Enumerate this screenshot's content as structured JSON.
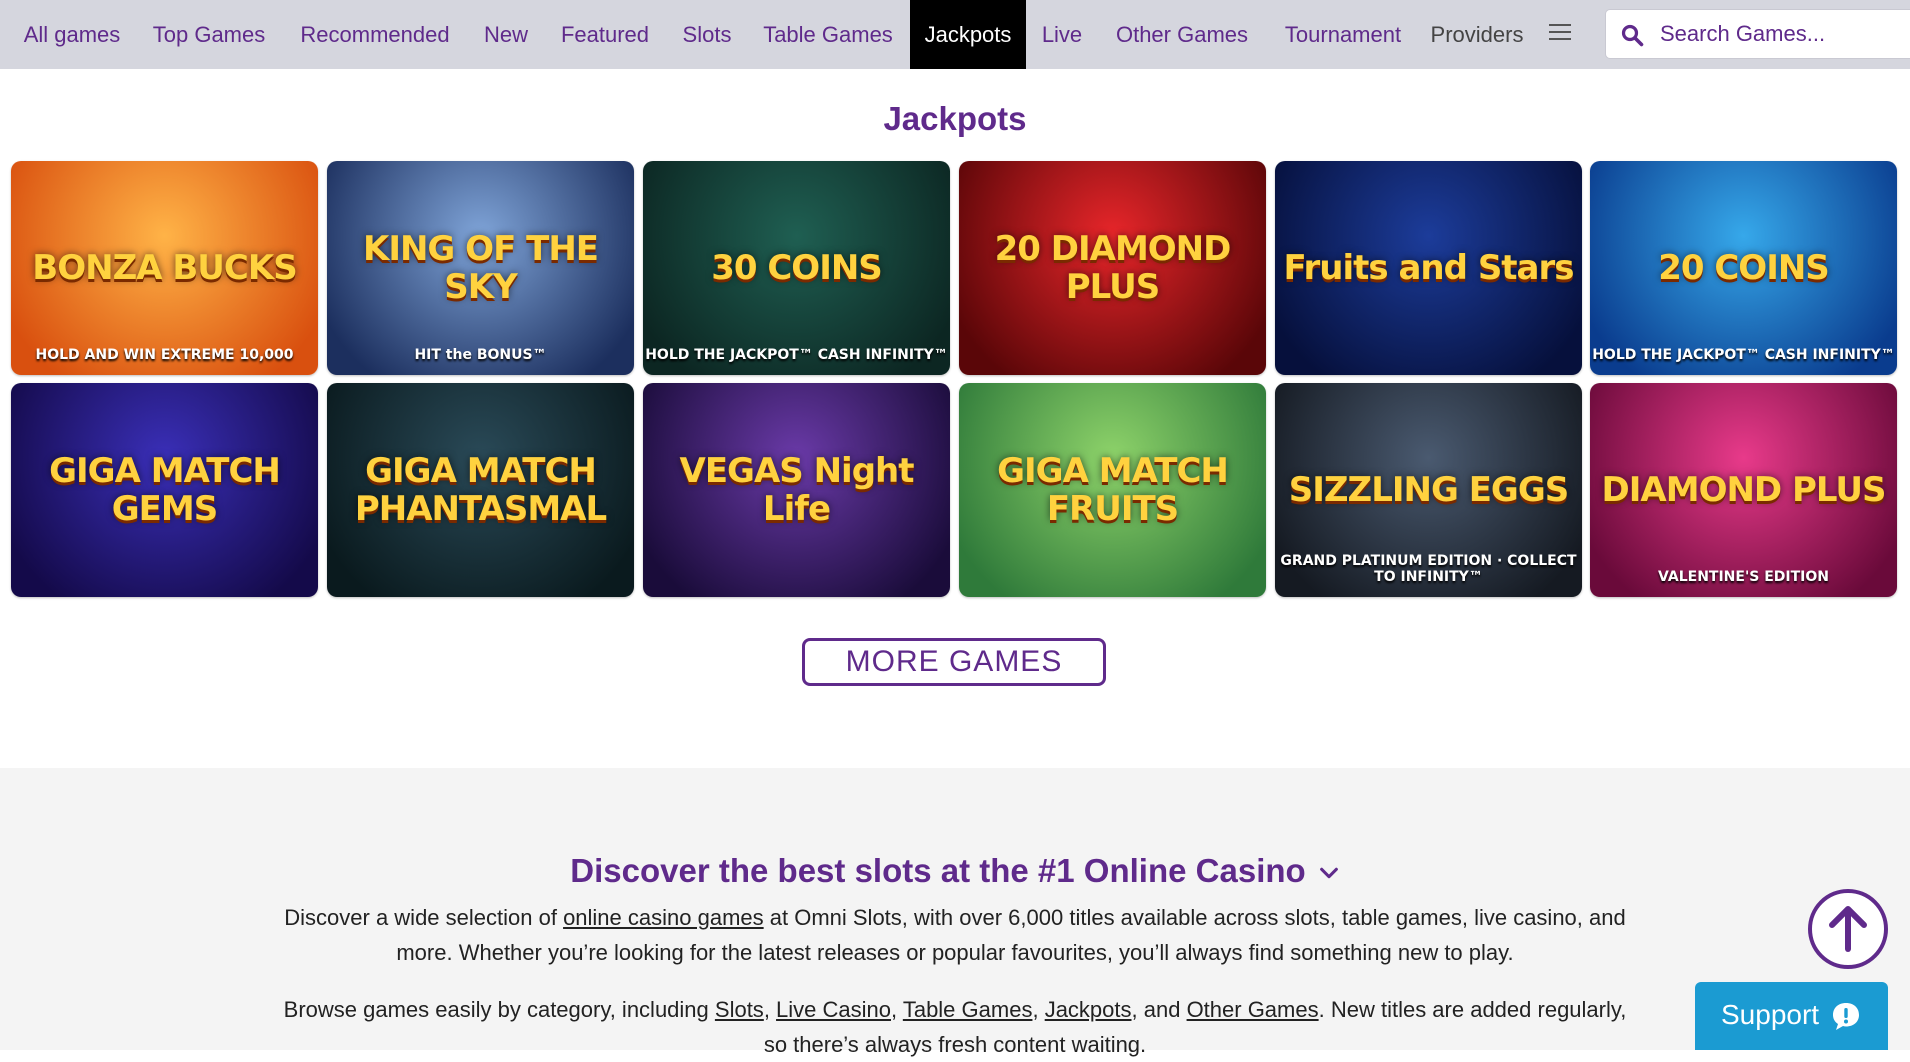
{
  "nav": {
    "items": [
      {
        "label": "All games",
        "active": false
      },
      {
        "label": "Top Games",
        "active": false
      },
      {
        "label": "Recommended",
        "active": false
      },
      {
        "label": "New",
        "active": false
      },
      {
        "label": "Featured",
        "active": false
      },
      {
        "label": "Slots",
        "active": false
      },
      {
        "label": "Table Games",
        "active": false
      },
      {
        "label": "Jackpots",
        "active": true
      },
      {
        "label": "Live",
        "active": false
      },
      {
        "label": "Other Games",
        "active": false
      },
      {
        "label": "Tournament",
        "active": false
      }
    ],
    "providers_label": "Providers",
    "menu_icon": "hamburger-menu-icon",
    "active_bg": "#000000",
    "text_color": "#5f2a8b"
  },
  "search": {
    "placeholder": "Search Games...",
    "value": "",
    "icon": "search-icon"
  },
  "jackpots": {
    "title": "Jackpots",
    "games": [
      {
        "name": "BONZA BUCKS",
        "sub": "HOLD AND WIN EXTREME 10,000",
        "bg": [
          "#ffb347",
          "#d9500f"
        ]
      },
      {
        "name": "KING OF THE SKY",
        "sub": "HIT the BONUS™",
        "bg": [
          "#7fa4d8",
          "#1c2f5e"
        ]
      },
      {
        "name": "30 COINS",
        "sub": "HOLD THE JACKPOT™ CASH INFINITY™",
        "bg": [
          "#1f5f52",
          "#0c2622"
        ]
      },
      {
        "name": "20 DIAMOND PLUS",
        "sub": "",
        "bg": [
          "#e8262a",
          "#5a0608"
        ]
      },
      {
        "name": "Fruits and Stars",
        "sub": "",
        "bg": [
          "#1c3c9a",
          "#06103c"
        ]
      },
      {
        "name": "20 COINS",
        "sub": "HOLD THE JACKPOT™ CASH INFINITY™",
        "bg": [
          "#36a8ea",
          "#0a3c8e"
        ]
      },
      {
        "name": "GIGA MATCH GEMS",
        "sub": "",
        "bg": [
          "#3a2fb8",
          "#140a4a"
        ]
      },
      {
        "name": "GIGA MATCH PHANTASMAL",
        "sub": "",
        "bg": [
          "#2a4a58",
          "#0a1a1e"
        ]
      },
      {
        "name": "VEGAS Night Life",
        "sub": "",
        "bg": [
          "#6a3aa8",
          "#1a0c3a"
        ]
      },
      {
        "name": "GIGA MATCH FRUITS",
        "sub": "",
        "bg": [
          "#8ed36a",
          "#2f7a3a"
        ]
      },
      {
        "name": "SIZZLING EGGS",
        "sub": "GRAND PLATINUM EDITION · COLLECT TO INFINITY™",
        "bg": [
          "#4a5a70",
          "#151a22"
        ]
      },
      {
        "name": "DIAMOND PLUS",
        "sub": "VALENTINE'S EDITION",
        "bg": [
          "#e83a8a",
          "#6a0a3a"
        ]
      }
    ],
    "more_label": "MORE GAMES"
  },
  "seo": {
    "heading": "Discover the best slots at the #1 Online Casino",
    "p1_before": "Discover a wide selection of ",
    "p1_link": "online casino games",
    "p1_after_line1": " at Omni Slots, with over 6,000 titles available across slots, table games, live casino, and",
    "p1_line2": "more. Whether you’re looking for the latest releases or popular favourites, you’ll always find something new to play.",
    "p2_before": "Browse games easily by category, including ",
    "p2_links": [
      "Slots",
      "Live Casino",
      "Table Games",
      "Jackpots",
      "Other Games"
    ],
    "p2_sep1": ", ",
    "p2_sep_and": ", and ",
    "p2_after": ". New titles are added regularly,",
    "p2_line2": "so there’s always fresh content waiting."
  },
  "support": {
    "label": "Support",
    "icon": "chat-bubble-exclamation-icon",
    "color": "#1b9bd2"
  },
  "scroll_top_icon": "arrow-up-circle-icon",
  "brand_color": "#5f2a8b"
}
